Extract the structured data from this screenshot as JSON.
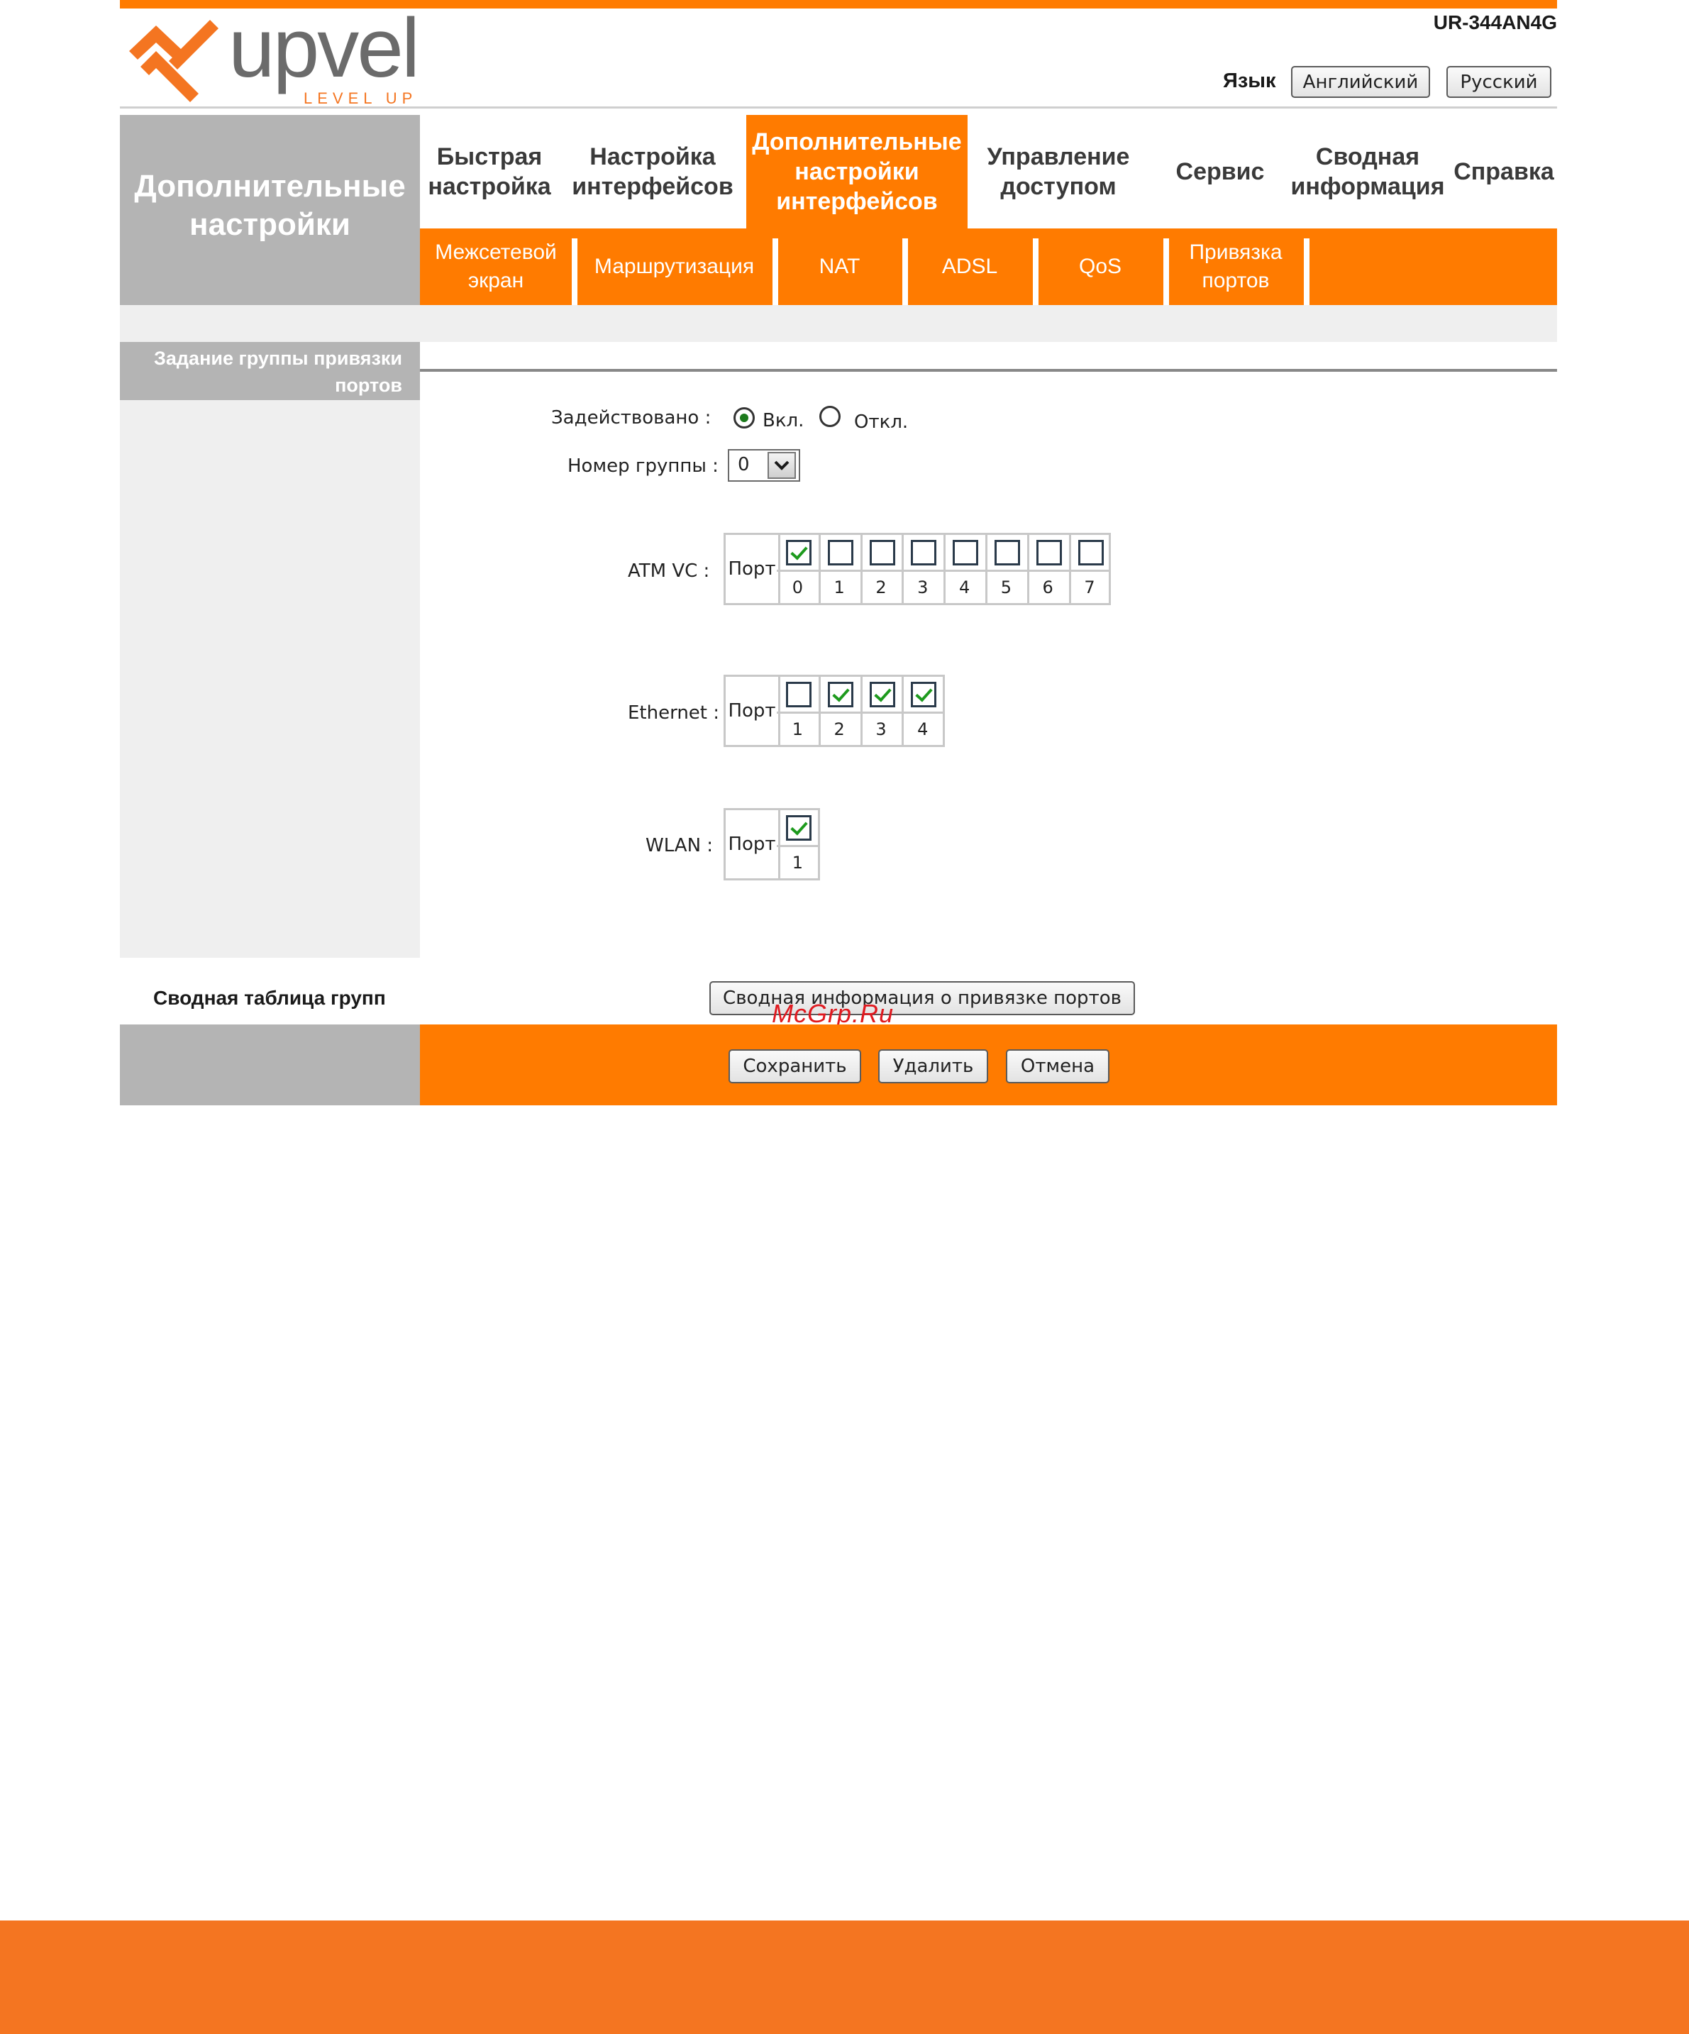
{
  "header": {
    "model": "UR-344AN4G",
    "logo_text": "upvel",
    "logo_tagline": "LEVEL UP",
    "language_label": "Язык",
    "lang_buttons": {
      "english": "Английский",
      "russian": "Русский"
    }
  },
  "section_title_line1": "Дополнительные",
  "section_title_line2": "настройки",
  "tabs": [
    {
      "line1": "Быстрая",
      "line2": "настройка"
    },
    {
      "line1": "Настройка",
      "line2": "интерфейсов"
    },
    {
      "line1": "Дополнительные",
      "line2": "настройки",
      "line3": "интерфейсов",
      "active": true
    },
    {
      "line1": "Управление",
      "line2": "доступом"
    },
    {
      "line1": "Сервис"
    },
    {
      "line1": "Сводная",
      "line2": "информация"
    },
    {
      "line1": "Справка"
    }
  ],
  "subtabs": [
    {
      "line1": "Межсетевой",
      "line2": "экран"
    },
    {
      "line1": "Маршрутизация"
    },
    {
      "line1": "NAT"
    },
    {
      "line1": "ADSL"
    },
    {
      "line1": "QoS"
    },
    {
      "line1": "Привязка",
      "line2": "портов"
    }
  ],
  "form": {
    "header_line1": "Задание группы привязки",
    "header_line2": "портов",
    "enabled_label": "Задействовано :",
    "enabled_on": "Вкл.",
    "enabled_off": "Откл.",
    "enabled_value": "on",
    "group_label": "Номер группы :",
    "group_value": "0",
    "port_word": "Порт",
    "atm": {
      "label": "ATM VC :",
      "ports": [
        "0",
        "1",
        "2",
        "3",
        "4",
        "5",
        "6",
        "7"
      ],
      "checked": [
        true,
        false,
        false,
        false,
        false,
        false,
        false,
        false
      ]
    },
    "ethernet": {
      "label": "Ethernet :",
      "ports": [
        "1",
        "2",
        "3",
        "4"
      ],
      "checked": [
        false,
        true,
        true,
        true
      ]
    },
    "wlan": {
      "label": "WLAN :",
      "ports": [
        "1"
      ],
      "checked": [
        true
      ]
    }
  },
  "summary": {
    "label": "Сводная таблица групп",
    "button": "Сводная информация о привязке портов"
  },
  "watermark": "McGrp.Ru",
  "footer_buttons": {
    "save": "Сохранить",
    "delete": "Удалить",
    "cancel": "Отмена"
  },
  "colors": {
    "accent": "#ff7b00",
    "grey_block": "#b4b4b4",
    "light_band": "#efefef",
    "page_footer": "#f47521"
  }
}
